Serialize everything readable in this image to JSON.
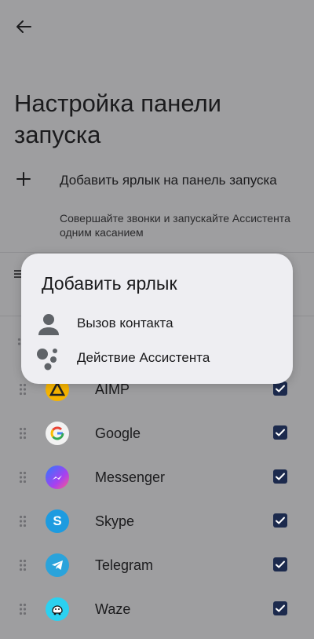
{
  "header": {
    "back_icon": "arrow-back-icon",
    "title": "Настройка панели запуска"
  },
  "add_shortcut": {
    "title": "Добавить ярлык на панель запуска",
    "description": "Совершайте звонки и запускайте Ассистента одним касанием",
    "icon": "plus-icon"
  },
  "apps": [
    {
      "label": "AIMP",
      "checked": true,
      "icon": "aimp-icon"
    },
    {
      "label": "Google",
      "checked": true,
      "icon": "google-icon"
    },
    {
      "label": "Messenger",
      "checked": true,
      "icon": "messenger-icon"
    },
    {
      "label": "Skype",
      "checked": true,
      "icon": "skype-icon"
    },
    {
      "label": "Telegram",
      "checked": true,
      "icon": "telegram-icon"
    },
    {
      "label": "Waze",
      "checked": true,
      "icon": "waze-icon"
    }
  ],
  "dialog": {
    "title": "Добавить ярлык",
    "items": [
      {
        "label": "Вызов контакта",
        "icon": "person-icon"
      },
      {
        "label": "Действие Ассистента",
        "icon": "assistant-icon"
      }
    ]
  },
  "colors": {
    "scrim_background": "#9e9ea0",
    "dialog_background": "#eeeef2",
    "checkbox": "#1c2a4d",
    "text": "#1b1b1d"
  }
}
